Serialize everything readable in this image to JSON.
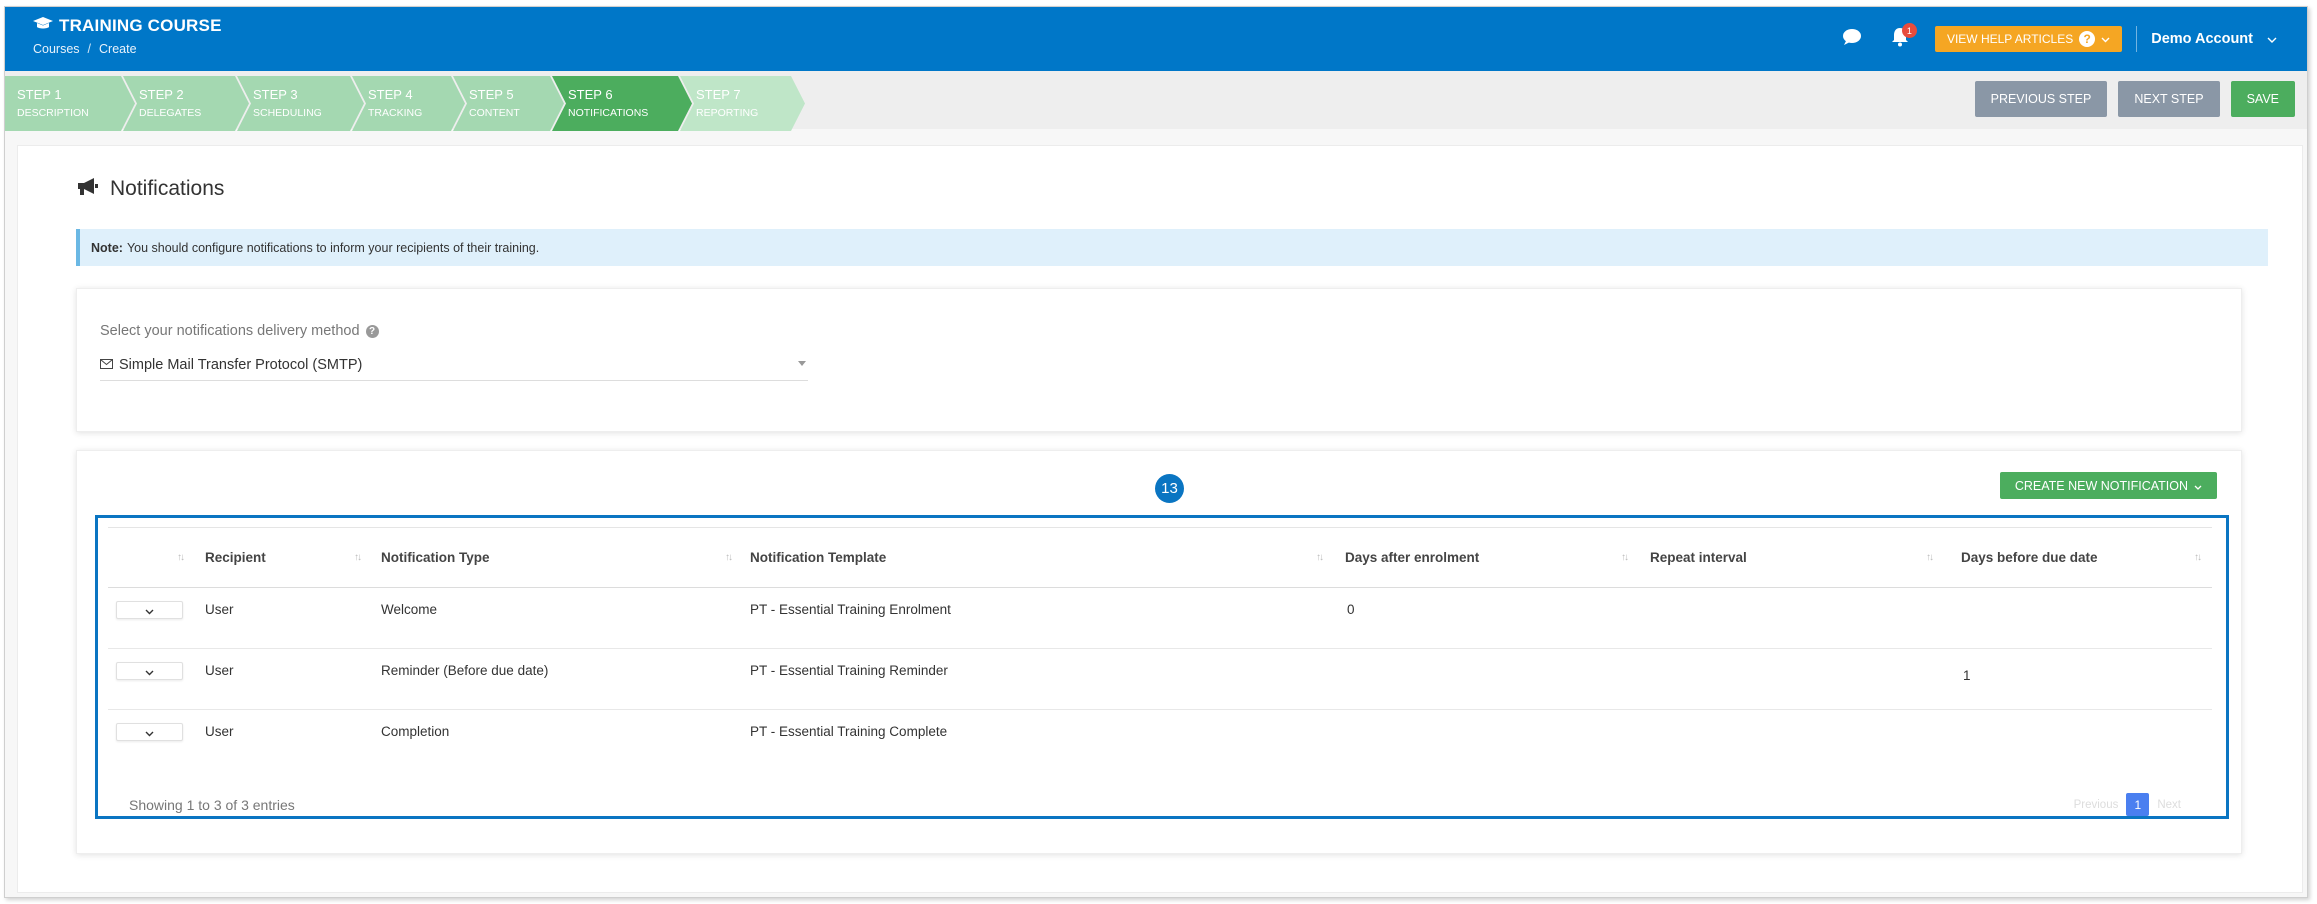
{
  "header": {
    "app_title": "TRAINING COURSE",
    "breadcrumb": [
      "Courses",
      "/",
      "Create"
    ],
    "notification_count": "1",
    "help_label": "VIEW HELP ARTICLES",
    "account_name": "Demo Account"
  },
  "steps": [
    {
      "num": "STEP 1",
      "label": "DESCRIPTION",
      "state": "done"
    },
    {
      "num": "STEP 2",
      "label": "DELEGATES",
      "state": "done"
    },
    {
      "num": "STEP 3",
      "label": "SCHEDULING",
      "state": "done"
    },
    {
      "num": "STEP 4",
      "label": "TRACKING",
      "state": "done"
    },
    {
      "num": "STEP 5",
      "label": "CONTENT",
      "state": "done"
    },
    {
      "num": "STEP 6",
      "label": "NOTIFICATIONS",
      "state": "active"
    },
    {
      "num": "STEP 7",
      "label": "REPORTING",
      "state": "todo"
    }
  ],
  "step_actions": {
    "previous": "PREVIOUS STEP",
    "next": "NEXT STEP",
    "save": "SAVE"
  },
  "page": {
    "title": "Notifications",
    "note_label": "Note:",
    "note_text": "You should configure notifications to inform your recipients of their training."
  },
  "delivery": {
    "label": "Select your notifications delivery method",
    "value": "Simple Mail Transfer Protocol (SMTP)"
  },
  "notifications": {
    "create_label": "CREATE NEW NOTIFICATION",
    "marker": "13",
    "columns": [
      "Recipient",
      "Notification Type",
      "Notification Template",
      "Days after enrolment",
      "Repeat interval",
      "Days before due date"
    ],
    "rows": [
      {
        "recipient": "User",
        "type": "Welcome",
        "template": "PT - Essential Training Enrolment",
        "days_after": "0",
        "repeat": "",
        "days_before": ""
      },
      {
        "recipient": "User",
        "type": "Reminder (Before due date)",
        "template": "PT - Essential Training Reminder",
        "days_after": "",
        "repeat": "",
        "days_before": "1"
      },
      {
        "recipient": "User",
        "type": "Completion",
        "template": "PT - Essential Training Complete",
        "days_after": "",
        "repeat": "",
        "days_before": ""
      }
    ],
    "showing": "Showing 1 to 3 of 3 entries",
    "pager": {
      "previous": "Previous",
      "page": "1",
      "next": "Next"
    }
  },
  "colors": {
    "topbar": "#0077c8",
    "step_active": "#4cad5e",
    "help_button": "#f5a623",
    "highlight": "#0a75c2"
  }
}
